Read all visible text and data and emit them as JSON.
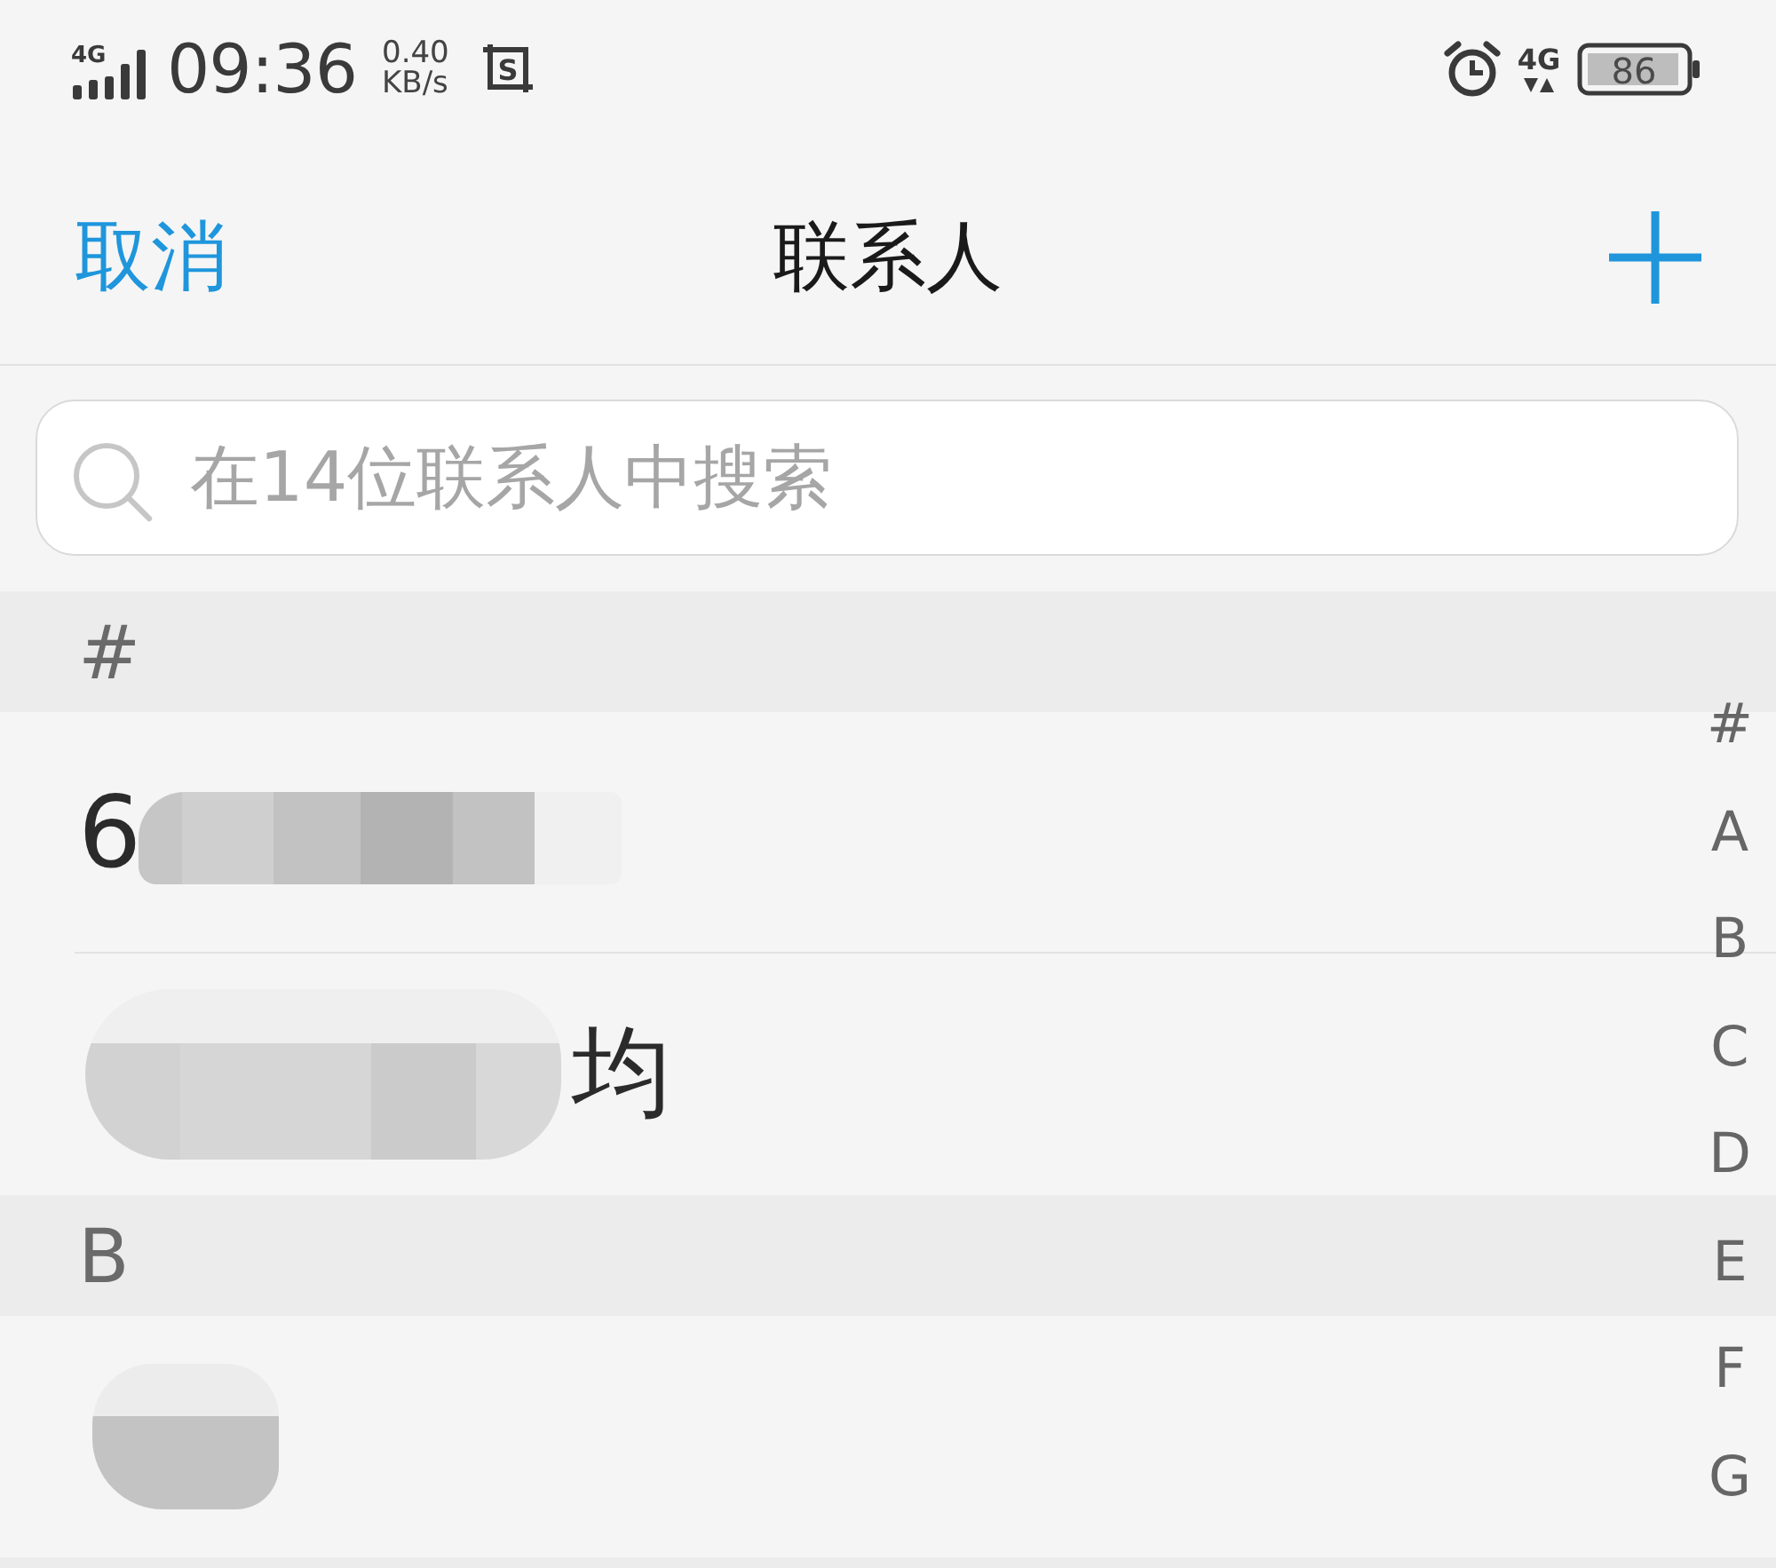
{
  "status_bar": {
    "signal_label": "4G",
    "time": "09:36",
    "speed_value": "0.40",
    "speed_unit": "KB/s",
    "capture_badge": "S",
    "network_label": "4G",
    "battery_text": "86"
  },
  "header": {
    "cancel": "取消",
    "title": "联系人"
  },
  "search": {
    "placeholder": "在14位联系人中搜索"
  },
  "sections": [
    {
      "heading": "#",
      "contacts": [
        {
          "parts": [
            {
              "kind": "text",
              "text": "6"
            },
            {
              "kind": "redaction"
            }
          ]
        },
        {
          "parts": [
            {
              "kind": "redaction"
            },
            {
              "kind": "text",
              "text": "均"
            }
          ]
        }
      ]
    },
    {
      "heading": "B",
      "contacts": [
        {
          "parts": [
            {
              "kind": "redaction"
            }
          ]
        }
      ]
    }
  ],
  "index": [
    "#",
    "A",
    "B",
    "C",
    "D",
    "E",
    "F",
    "G"
  ]
}
